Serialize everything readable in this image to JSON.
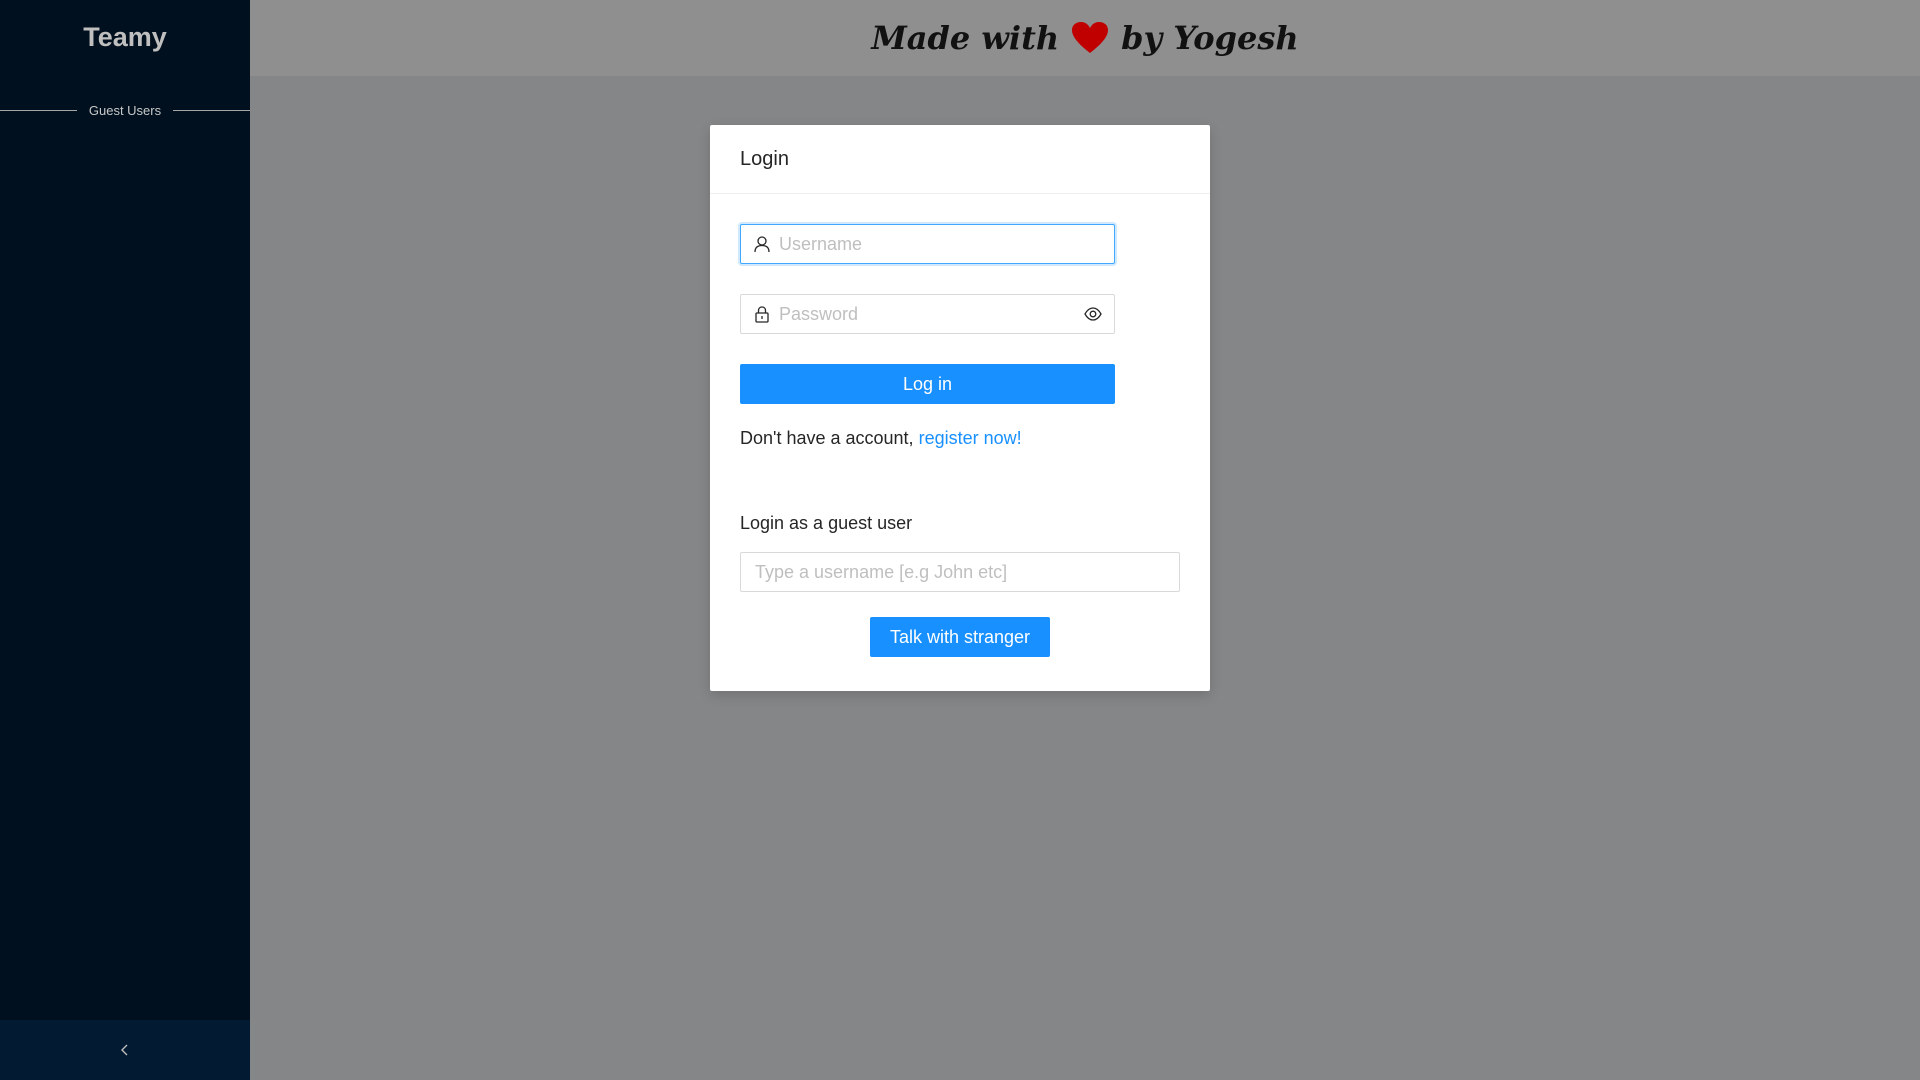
{
  "sidebar": {
    "brand": "Teamy",
    "section_label": "Guest Users",
    "collapse_icon": "chevron-left-icon"
  },
  "header": {
    "text_before": "Made with",
    "heart_icon": "heart-icon",
    "heart_color": "#c00000",
    "text_after": "by Yogesh"
  },
  "modal": {
    "title": "Login",
    "username": {
      "value": "",
      "placeholder": "Username",
      "icon": "user-icon"
    },
    "password": {
      "value": "",
      "placeholder": "Password",
      "icon": "lock-icon",
      "toggle_icon": "eye-icon"
    },
    "login_button": "Log in",
    "register_prefix": "Don't have a account,",
    "register_link": "register now!",
    "guest_label": "Login as a guest user",
    "guest_input": {
      "value": "",
      "placeholder": "Type a username [e.g John etc]"
    },
    "guest_button": "Talk with stranger"
  },
  "colors": {
    "primary": "#1890ff",
    "sidebar_bg": "#01101e",
    "overlay_bg": "#858687"
  }
}
